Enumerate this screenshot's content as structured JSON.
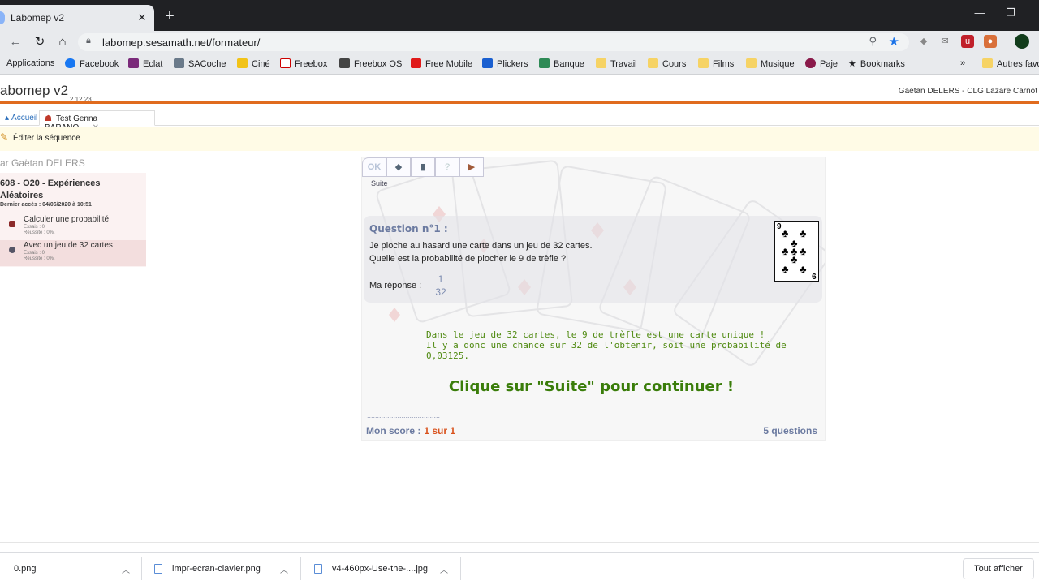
{
  "browser": {
    "tab_title": "Labomep v2",
    "url": "labomep.sesamath.net/formateur/",
    "bookmarks": [
      "Applications",
      "Facebook",
      "Eclat",
      "SACoche",
      "Ciné",
      "Freebox",
      "Freebox OS",
      "Free Mobile",
      "Plickers",
      "Banque",
      "Travail",
      "Cours",
      "Films",
      "Musique",
      "Paje",
      "Bookmarks",
      "Autres favo"
    ]
  },
  "app": {
    "name": "abomep v2",
    "version": "2.12.23",
    "user": "Gaëtan DELERS - CLG Lazare Carnot",
    "tabs": {
      "home": "Accueil",
      "active": "Test Genna BARANO..."
    },
    "edit_label": "Éditer la séquence"
  },
  "sidebar": {
    "author": "ar Gaëtan DELERS",
    "sequence_title": "608 - O20 - Expériences Aléatoires",
    "last_access": "Dernier accès : 04/06/2020 à 10:51",
    "items": [
      {
        "name": "Calculer une probabilité",
        "essais": "Essais : 0",
        "reussite": "Réussite : 0%,"
      },
      {
        "name": "Avec un jeu de 32 cartes",
        "essais": "Essais : 0",
        "reussite": "Réussite : 0%,"
      }
    ]
  },
  "exercise": {
    "toolbar_ok": "OK",
    "suite_label": "Suite",
    "question_title": "Question n°1 :",
    "question_line1": "Je pioche au hasard une carte dans un jeu de 32 cartes.",
    "question_line2": "Quelle est la probabilité de piocher le 9 de trèfle ?",
    "answer_label": "Ma réponse :",
    "answer_numerator": "1",
    "answer_denominator": "32",
    "card_rank": "9",
    "feedback_line1": "Dans le jeu de 32 cartes, le 9 de trèfle est une carte unique !",
    "feedback_line2": "Il y a donc une chance sur 32 de l'obtenir, soit une probabilité de 0,03125.",
    "continue": "Clique sur \"Suite\" pour continuer !",
    "dots": "....................................",
    "score_label": "Mon score :",
    "score_value": "1 sur 1",
    "questions_count": "5 questions"
  },
  "downloads": {
    "files": [
      "0.png",
      "impr-ecran-clavier.png",
      "v4-460px-Use-the-....jpg"
    ],
    "show_all": "Tout afficher"
  },
  "colors": {
    "accent": "#e06b1e",
    "feedback": "#4f8a10",
    "score_value": "#d9531e",
    "question": "#6b7aa0"
  }
}
